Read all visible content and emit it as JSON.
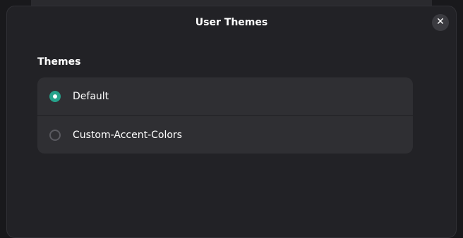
{
  "dialog": {
    "title": "User Themes",
    "close_label": "✕"
  },
  "themes": {
    "heading": "Themes",
    "options": [
      {
        "label": "Default",
        "selected": true
      },
      {
        "label": "Custom-Accent-Colors",
        "selected": false
      }
    ]
  },
  "colors": {
    "accent": "#26a28b",
    "dialog_background": "#222226",
    "list_background": "#2f2f33"
  }
}
